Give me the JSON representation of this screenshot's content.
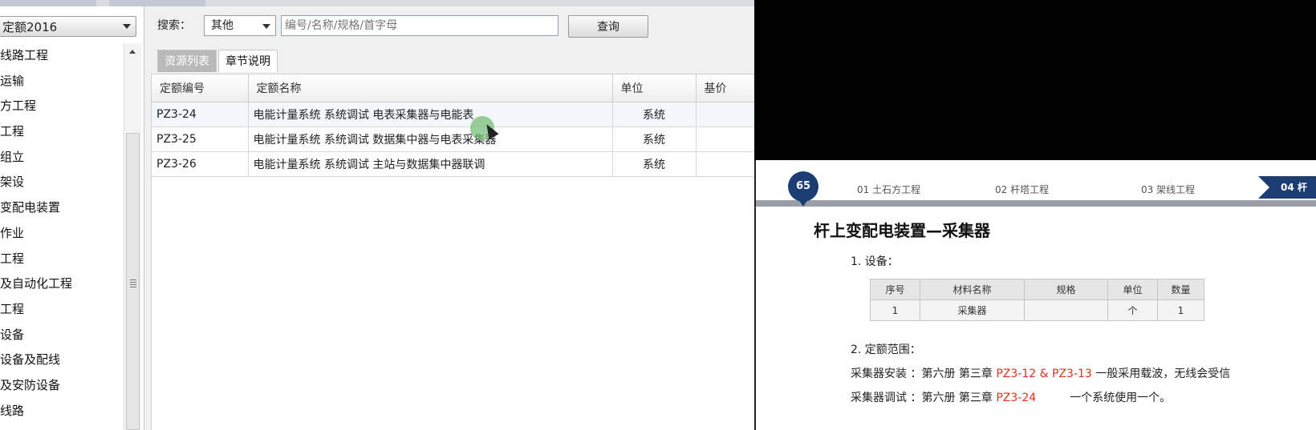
{
  "left_panel": {
    "library_select": "定额2016",
    "tree_items": [
      "线路工程",
      "运输",
      "方工程",
      "工程",
      "组立",
      "架设",
      "变配电装置",
      "作业",
      "工程",
      "及自动化工程",
      "工程",
      "设备",
      "设备及配线",
      "及安防设备",
      "线路"
    ]
  },
  "search": {
    "label": "搜索：",
    "type_value": "其他",
    "placeholder": "编号/名称/规格/首字母",
    "button": "查询"
  },
  "tabs": [
    {
      "label": "资源列表",
      "active": true
    },
    {
      "label": "章节说明",
      "active": false
    }
  ],
  "grid": {
    "columns": [
      "定额编号",
      "定额名称",
      "单位",
      "基价"
    ],
    "rows": [
      {
        "code": "PZ3-24",
        "name": "电能计量系统 系统调试 电表采集器与电能表",
        "unit": "系统"
      },
      {
        "code": "PZ3-25",
        "name": "电能计量系统 系统调试 数据集中器与电表采集器",
        "unit": "系统"
      },
      {
        "code": "PZ3-26",
        "name": "电能计量系统 系统调试 主站与数据集中器联调",
        "unit": "系统"
      }
    ]
  },
  "doc": {
    "page_number": "65",
    "chapters": [
      "01 土石方工程",
      "02 杆塔工程",
      "03 架线工程",
      "04 杆"
    ],
    "title": "杆上变配电装置—采集器",
    "section1": "1. 设备：",
    "equip_table": {
      "headers": [
        "序号",
        "材料名称",
        "规格",
        "单位",
        "数量"
      ],
      "rows": [
        [
          "1",
          "采集器",
          "",
          "个",
          "1"
        ]
      ]
    },
    "section2": "2. 定额范围：",
    "line1": {
      "prefix": "采集器安装 ：第六册 第三章 ",
      "code1": "PZ3-12",
      "amp": " & ",
      "code2": "PZ3-13",
      "suffix": " 一般采用载波，无线会受信"
    },
    "line2": {
      "prefix": "采集器调试 ：第六册 第三章 ",
      "code1": "PZ3-24",
      "suffix": "一个系统使用一个。"
    },
    "accent_color": "#1c3d72",
    "highlight_color": "#e0301e"
  }
}
